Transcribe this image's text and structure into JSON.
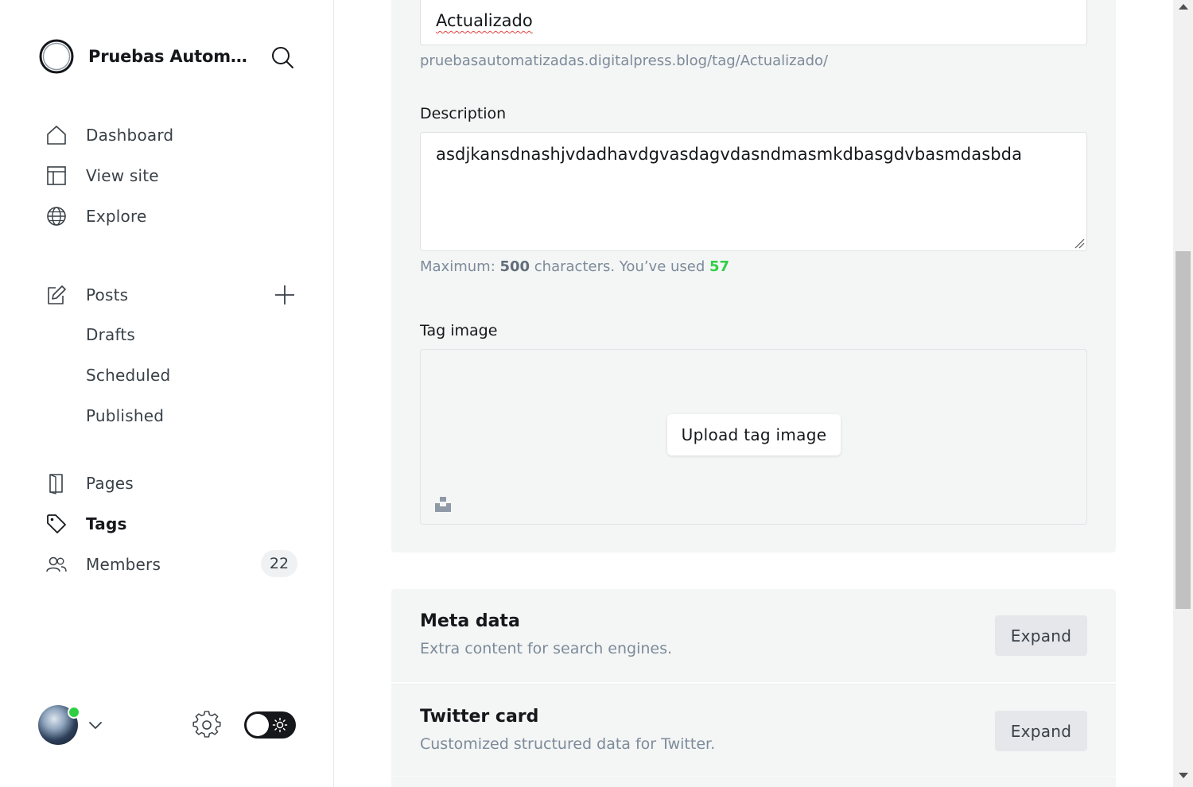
{
  "sidebar": {
    "site_name": "Pruebas Automatizadas",
    "nav": {
      "dashboard": "Dashboard",
      "view_site": "View site",
      "explore": "Explore",
      "posts": "Posts",
      "drafts": "Drafts",
      "scheduled": "Scheduled",
      "published": "Published",
      "pages": "Pages",
      "tags": "Tags",
      "members": "Members",
      "members_count": "22"
    },
    "active_item": "Tags",
    "theme": "dark-mode-toggle"
  },
  "tag_form": {
    "slug_value": "Actualizado",
    "url_hint": "pruebasautomatizadas.digitalpress.blog/tag/Actualizado/",
    "description_label": "Description",
    "description_value": "asdjkansdnashjvdadhavdgvasdagvdasndmasmkdbasgdvbasmdasbda",
    "char_hint_prefix": "Maximum: ",
    "char_max": "500",
    "char_hint_mid": " characters. You’ve used ",
    "char_used": "57",
    "tag_image_label": "Tag image",
    "upload_label": "Upload tag image"
  },
  "sections": [
    {
      "title": "Meta data",
      "subtitle": "Extra content for search engines.",
      "button": "Expand"
    },
    {
      "title": "Twitter card",
      "subtitle": "Customized structured data for Twitter.",
      "button": "Expand"
    }
  ],
  "colors": {
    "accent_green": "#30cf43",
    "text_dark": "#15171a",
    "text_muted": "#7c8b9a",
    "panel_bg": "#f4f5f5"
  }
}
